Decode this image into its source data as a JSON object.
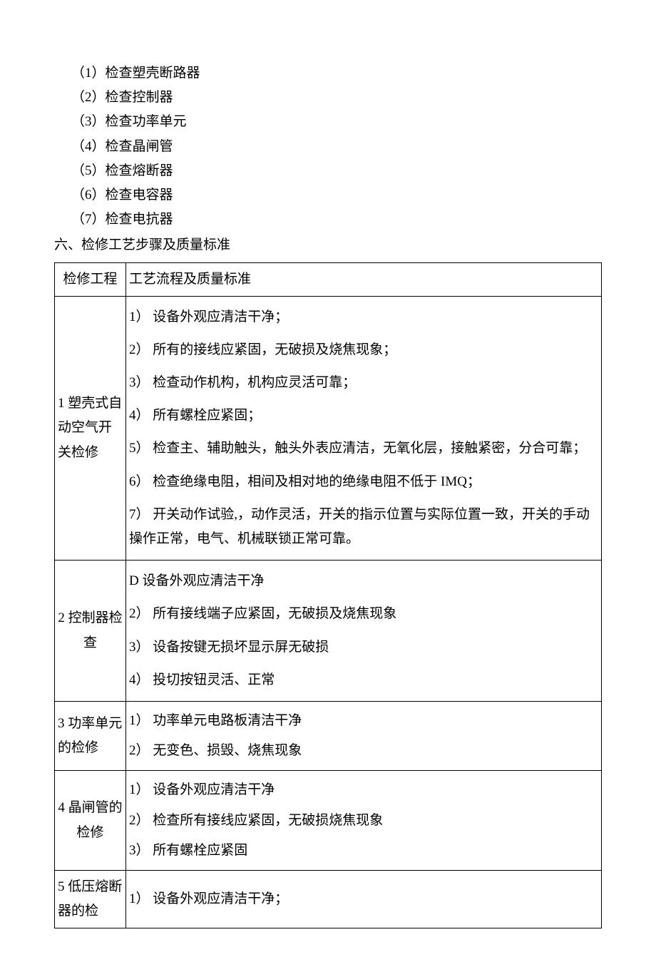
{
  "intro_list": {
    "items": [
      "（1）检查塑壳断路器",
      "（2）检查控制器",
      "（3）检查功率单元",
      "（4）检查晶闸管",
      "（5）检查熔断器",
      "（6）检查电容器",
      "（7）检查电抗器"
    ]
  },
  "section_heading": "六、检修工艺步骤及质量标准",
  "table": {
    "header": {
      "c1": "检修工程",
      "c2": "工艺流程及质量标准"
    },
    "rows": [
      {
        "name": "1 塑壳式自动空气开关检修",
        "align": "left",
        "steps": [
          "1） 设备外观应清洁干净；",
          "2） 所有的接线应紧固，无破损及烧焦现象；",
          "3） 检查动作机构，机构应灵活可靠；",
          "4） 所有螺栓应紧固；",
          "5） 检查主、辅助触头，触头外表应清洁，无氧化层，接触紧密，分合可靠；",
          "6） 检查绝缘电阻，相间及相对地的绝缘电阻不低于 IMQ；",
          "7） 开关动作试验,，动作灵活，开关的指示位置与实际位置一致，开关的手动操作正常，电气、机械联锁正常可靠。"
        ]
      },
      {
        "name": "2 控制器检查",
        "align": "center",
        "steps": [
          "D 设备外观应清洁干净",
          "2） 所有接线端子应紧固，无破损及烧焦现象",
          "3） 设备按键无损坏显示屏无破损",
          "4） 投切按钮灵活、正常"
        ]
      },
      {
        "name": "3 功率单元的检修",
        "align": "left",
        "steps": [
          "1） 功率单元电路板清洁干净",
          "2） 无变色、损毁、烧焦现象"
        ]
      },
      {
        "name": "4 晶闸管的检修",
        "align": "center",
        "steps": [
          "1） 设备外观应清洁干净",
          "2） 检查所有接线应紧固，无破损烧焦现象",
          "3） 所有螺栓应紧固"
        ]
      },
      {
        "name": "5 低压熔断器的检",
        "align": "left",
        "steps": [
          "1） 设备外观应清洁干净；"
        ]
      }
    ]
  }
}
